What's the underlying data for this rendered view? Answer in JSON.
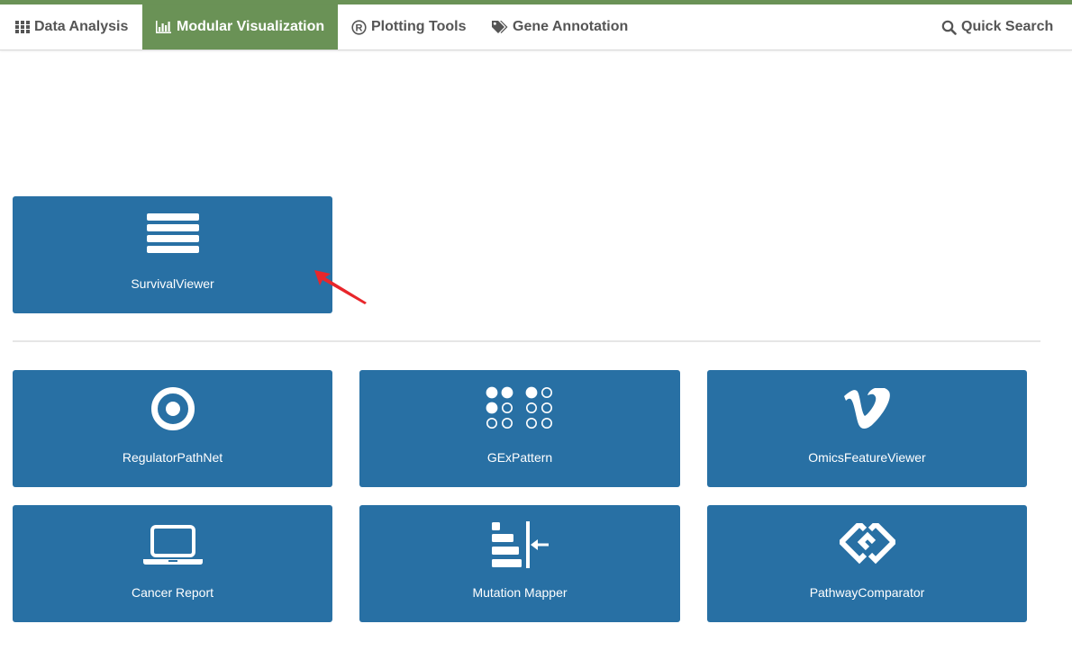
{
  "nav": {
    "items": [
      {
        "label": "Data Analysis",
        "icon": "grid-icon",
        "active": false
      },
      {
        "label": "Modular Visualization",
        "icon": "bar-chart-icon",
        "active": true
      },
      {
        "label": "Plotting Tools",
        "icon": "registered-icon",
        "active": false
      },
      {
        "label": "Gene Annotation",
        "icon": "tags-icon",
        "active": false
      }
    ],
    "search_label": "Quick Search"
  },
  "featured": {
    "label": "SurvivalViewer",
    "icon": "list-icon"
  },
  "tools": [
    {
      "label": "RegulatorPathNet",
      "icon": "target-icon"
    },
    {
      "label": "GExPattern",
      "icon": "dot-matrix-icon"
    },
    {
      "label": "OmicsFeatureViewer",
      "icon": "vimeo-icon"
    },
    {
      "label": "Cancer Report",
      "icon": "laptop-icon"
    },
    {
      "label": "Mutation Mapper",
      "icon": "align-arrow-icon"
    },
    {
      "label": "PathwayComparator",
      "icon": "linked-diamonds-icon"
    }
  ],
  "colors": {
    "accent_green": "#6a9256",
    "card_blue": "#2870a4",
    "annotation_arrow": "#e8262b"
  }
}
